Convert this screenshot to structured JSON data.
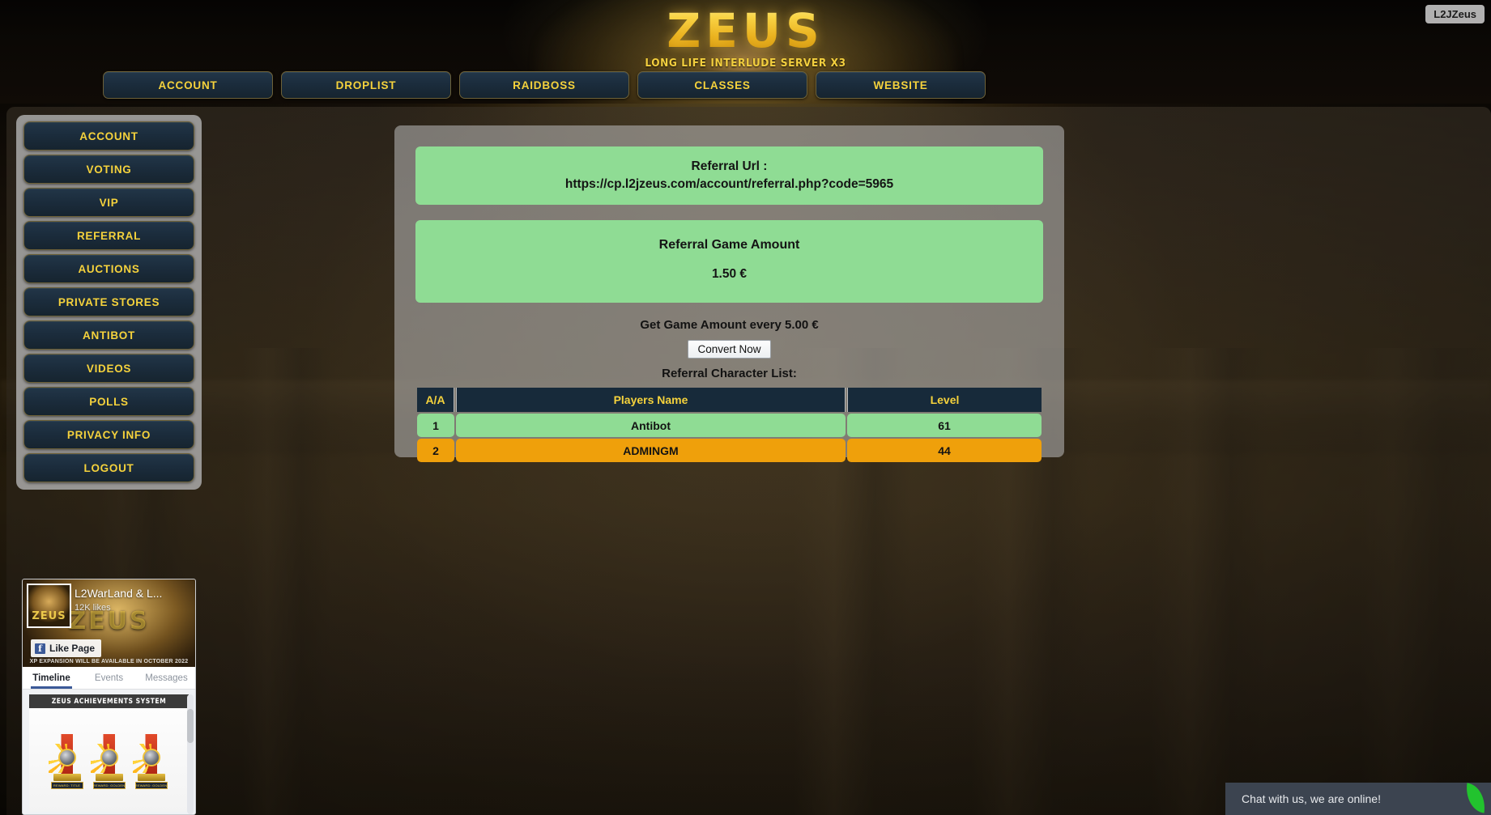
{
  "site": {
    "logo_main": "ZEUS",
    "logo_sub": "LONG LIFE INTERLUDE SERVER X3",
    "corner_badge": "L2JZeus"
  },
  "topnav": {
    "items": [
      {
        "label": "ACCOUNT"
      },
      {
        "label": "DROPLIST"
      },
      {
        "label": "RAIDBOSS"
      },
      {
        "label": "CLASSES"
      },
      {
        "label": "WEBSITE"
      }
    ]
  },
  "sidebar": {
    "items": [
      {
        "label": "ACCOUNT"
      },
      {
        "label": "VOTING"
      },
      {
        "label": "VIP"
      },
      {
        "label": "REFERRAL"
      },
      {
        "label": "AUCTIONS"
      },
      {
        "label": "PRIVATE STORES"
      },
      {
        "label": "ANTIBOT"
      },
      {
        "label": "VIDEOS"
      },
      {
        "label": "POLLS"
      },
      {
        "label": "PRIVACY INFO"
      },
      {
        "label": "LOGOUT"
      }
    ]
  },
  "facebook": {
    "page_title": "L2WarLand & L...",
    "likes": "12K likes",
    "like_button": "Like Page",
    "cover_zeus": "ZEUS",
    "cover_note": "XP EXPANSION WILL BE AVAILABLE IN OCTOBER 2022",
    "avatar_text": "ZEUS",
    "tabs": [
      {
        "label": "Timeline",
        "active": true
      },
      {
        "label": "Events",
        "active": false
      },
      {
        "label": "Messages",
        "active": false
      }
    ],
    "post_banner": "ZEUS ACHIEVEMENTS SYSTEM",
    "medals": [
      {
        "label": "REWARD: TITLE"
      },
      {
        "label": "REWARD: GOLDEN"
      },
      {
        "label": "REWARD: GOLDEN"
      }
    ]
  },
  "main": {
    "referral_url_label": "Referral Url :",
    "referral_url": "https://cp.l2jzeus.com/account/referral.php?code=5965",
    "game_amount_title": "Referral Game Amount",
    "game_amount_value": "1.50 €",
    "hint": "Get Game Amount every 5.00 €",
    "convert_button": "Convert Now",
    "list_title": "Referral Character List:",
    "table": {
      "columns": [
        "A/A",
        "Players Name",
        "Level"
      ],
      "rows": [
        {
          "aa": "1",
          "name": "Antibot",
          "level": "61",
          "style": "row-green"
        },
        {
          "aa": "2",
          "name": "ADMINGM",
          "level": "44",
          "style": "row-orange"
        }
      ]
    }
  },
  "chat": {
    "message": "Chat with us, we are online!"
  },
  "colors": {
    "accent_gold": "#f5d23c",
    "nav_bg": "#1b2c3c",
    "green": "#8fdc94",
    "orange": "#efa00b",
    "table_header": "#172a3a"
  }
}
